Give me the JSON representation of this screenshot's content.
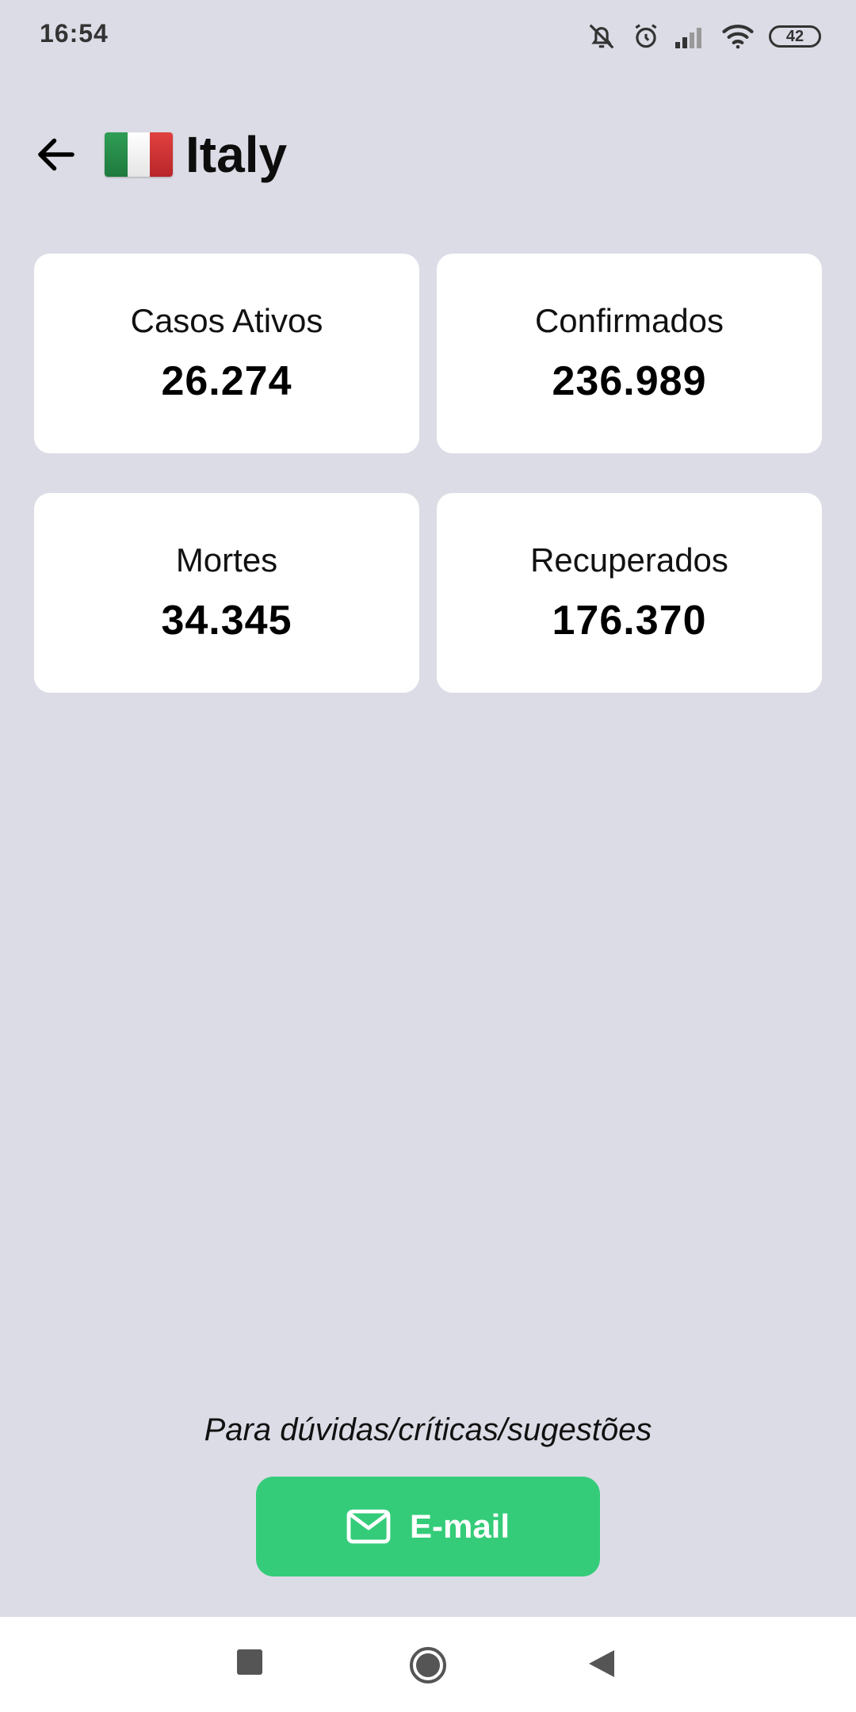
{
  "status_bar": {
    "time": "16:54",
    "battery": "42",
    "icons": [
      "bell-muted-icon",
      "alarm-icon",
      "signal-icon",
      "wifi-icon",
      "battery-icon"
    ]
  },
  "header": {
    "back_icon": "arrow-left-icon",
    "flag": "italy-flag",
    "country": "Italy"
  },
  "stats": [
    {
      "label": "Casos Ativos",
      "value": "26.274"
    },
    {
      "label": "Confirmados",
      "value": "236.989"
    },
    {
      "label": "Mortes",
      "value": "34.345"
    },
    {
      "label": "Recuperados",
      "value": "176.370"
    }
  ],
  "footer": {
    "contact_text": "Para dúvidas/críticas/sugestões",
    "email_label": "E-mail",
    "email_icon": "mail-icon"
  },
  "nav_bar": {
    "icons": [
      "recents-square-icon",
      "home-circle-icon",
      "back-triangle-icon"
    ]
  },
  "colors": {
    "background": "#dcdce6",
    "card": "#ffffff",
    "accent": "#34cc79"
  }
}
